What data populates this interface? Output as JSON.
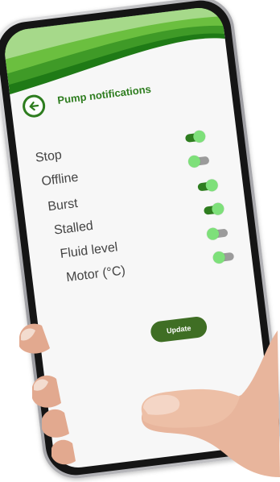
{
  "header": {
    "title": "Pump notifications",
    "back_icon": "arrow-left-icon"
  },
  "notifications": [
    {
      "label": "Stop",
      "enabled": true
    },
    {
      "label": "Offline",
      "enabled": false
    },
    {
      "label": "Burst",
      "enabled": true
    },
    {
      "label": "Stalled",
      "enabled": true
    },
    {
      "label": "Fluid level",
      "enabled": false
    },
    {
      "label": "Motor (°C)",
      "enabled": false
    }
  ],
  "actions": {
    "update_label": "Update"
  },
  "colors": {
    "primary": "#2e7d1f",
    "accent": "#7ee07a",
    "button": "#3f6e24",
    "toggle_off": "#9b9b9b"
  }
}
